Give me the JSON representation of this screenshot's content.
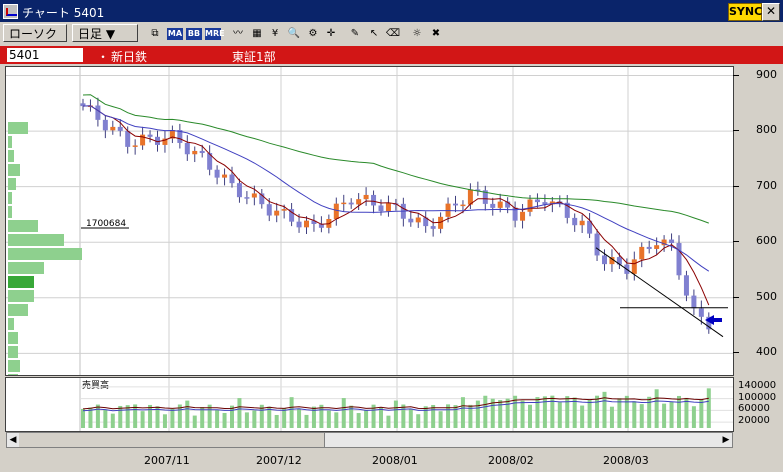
{
  "window": {
    "title": "チャート 5401",
    "sync_label": "SYNC",
    "close_glyph": "✕"
  },
  "toolbar": {
    "chart_type": "ローソク ▼",
    "period": "日足 ▼",
    "tools": [
      "MA",
      "BB",
      "MRE"
    ]
  },
  "info": {
    "code": "5401",
    "bullet": "・",
    "name": "新日鉄",
    "market": "東証1部"
  },
  "chart_data": {
    "type": "candlestick",
    "x_ticks": [
      "2007/11",
      "2007/12",
      "2008/01",
      "2008/02",
      "2008/03"
    ],
    "price_ticks": [
      900,
      800,
      700,
      600,
      500,
      400
    ],
    "ylim": [
      370,
      910
    ],
    "volume_label": "売買高",
    "volume_ticks": [
      "140000",
      "100000",
      "60000",
      "20000"
    ],
    "volume_ylim": [
      0,
      160000
    ],
    "volume_profile_label": "1700684",
    "grid": true,
    "colors": {
      "up": "#e8732a",
      "down": "#8080d0",
      "ma_short": "#8b0000",
      "ma_mid": "#4040c0",
      "ma_long": "#2a8a2a",
      "volume": "#8ed08e"
    }
  }
}
